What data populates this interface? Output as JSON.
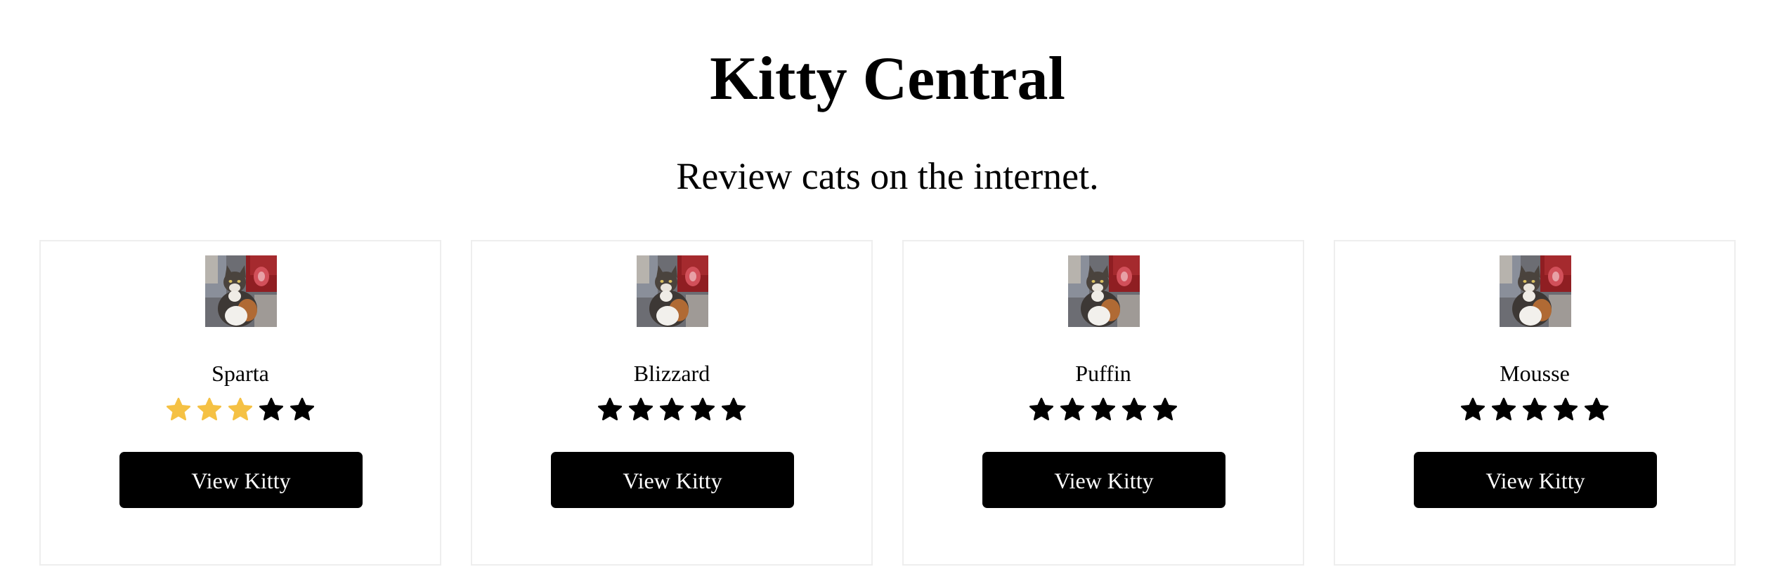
{
  "header": {
    "title": "Kitty Central",
    "subtitle": "Review cats on the internet."
  },
  "colors": {
    "star_filled": "#f5c144",
    "star_empty": "#000000",
    "button_bg": "#000000",
    "button_text": "#ffffff",
    "card_border": "#eeeeee"
  },
  "cards": [
    {
      "name": "Sparta",
      "rating": 3,
      "max_rating": 5,
      "button_label": "View Kitty",
      "image_icon": "cat-photo"
    },
    {
      "name": "Blizzard",
      "rating": 0,
      "max_rating": 5,
      "button_label": "View Kitty",
      "image_icon": "cat-photo"
    },
    {
      "name": "Puffin",
      "rating": 0,
      "max_rating": 5,
      "button_label": "View Kitty",
      "image_icon": "cat-photo"
    },
    {
      "name": "Mousse",
      "rating": 0,
      "max_rating": 5,
      "button_label": "View Kitty",
      "image_icon": "cat-photo"
    }
  ]
}
